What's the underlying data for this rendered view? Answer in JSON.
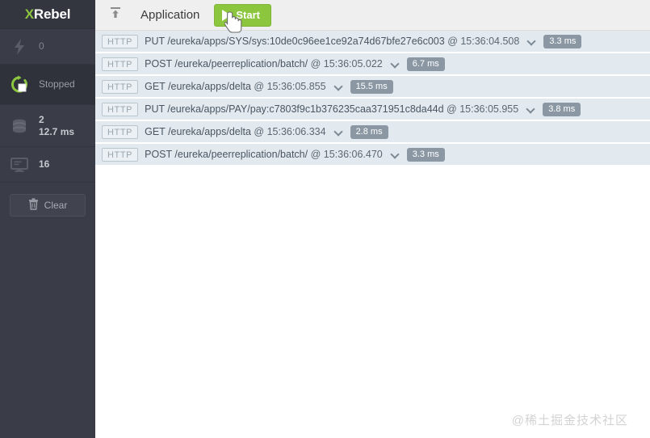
{
  "brand": {
    "prefix": "X",
    "name": "Rebel"
  },
  "sidebar": {
    "metrics": [
      {
        "icon": "lightning-icon",
        "value": "0",
        "label": ""
      },
      {
        "icon": "stopwatch-stop-icon",
        "value": "",
        "label": "Stopped"
      },
      {
        "icon": "database-icon",
        "value": "2",
        "sub": "12.7 ms",
        "label": ""
      },
      {
        "icon": "monitor-icon",
        "value": "16",
        "label": ""
      }
    ],
    "clear_button": {
      "label": "Clear",
      "icon": "trash-icon"
    }
  },
  "toolbar": {
    "upload_icon": "upload-icon",
    "title": "Application",
    "start_label": "Start",
    "start_icon": "play-icon",
    "start_color": "#8cc63e"
  },
  "requests": [
    {
      "protocol": "HTTP",
      "method": "PUT",
      "path": "/eureka/apps/SYS/sys:10de0c96ee1ce92a74d67bfe27e6c003",
      "at": "@ 15:36:04.508",
      "duration": "3.3 ms"
    },
    {
      "protocol": "HTTP",
      "method": "POST",
      "path": "/eureka/peerreplication/batch/",
      "at": "@ 15:36:05.022",
      "duration": "6.7 ms"
    },
    {
      "protocol": "HTTP",
      "method": "GET",
      "path": "/eureka/apps/delta",
      "at": "@ 15:36:05.855",
      "duration": "15.5 ms"
    },
    {
      "protocol": "HTTP",
      "method": "PUT",
      "path": "/eureka/apps/PAY/pay:c7803f9c1b376235caa371951c8da44d",
      "at": "@ 15:36:05.955",
      "duration": "3.8 ms"
    },
    {
      "protocol": "HTTP",
      "method": "GET",
      "path": "/eureka/apps/delta",
      "at": "@ 15:36:06.334",
      "duration": "2.8 ms"
    },
    {
      "protocol": "HTTP",
      "method": "POST",
      "path": "/eureka/peerreplication/batch/",
      "at": "@ 15:36:06.470",
      "duration": "3.3 ms"
    }
  ],
  "watermark": "@稀土掘金技术社区"
}
